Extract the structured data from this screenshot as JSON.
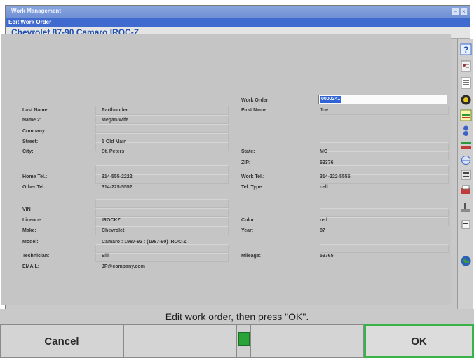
{
  "window": {
    "title": "Work Management",
    "subtitle": "Edit Work Order",
    "vehicle": "Chevrolet 87-90 Camaro IROC-Z"
  },
  "form": {
    "work_order": {
      "label": "Work Order:",
      "value": "0000241"
    },
    "last_name": {
      "label": "Last Name:",
      "value": "Parthunder"
    },
    "first_name": {
      "label": "First Name:",
      "value": "Joe"
    },
    "name2": {
      "label": "Name 2:",
      "value": "Megan-wife"
    },
    "company": {
      "label": "Company:",
      "value": ""
    },
    "street": {
      "label": "Street:",
      "value": "1 Old Main"
    },
    "city": {
      "label": "City:",
      "value": "St. Peters"
    },
    "state": {
      "label": "State:",
      "value": "MO"
    },
    "zip": {
      "label": "ZIP:",
      "value": "63376"
    },
    "home_tel": {
      "label": "Home Tel.:",
      "value": "314-555-2222"
    },
    "work_tel": {
      "label": "Work Tel.:",
      "value": "314-222-5555"
    },
    "other_tel": {
      "label": "Other Tel.:",
      "value": "314-225-5552"
    },
    "tel_type": {
      "label": "Tel. Type:",
      "value": "cell"
    },
    "vin": {
      "label": "VIN",
      "value": ""
    },
    "licence": {
      "label": "Licence:",
      "value": "IROCKZ"
    },
    "color": {
      "label": "Color:",
      "value": "red"
    },
    "make": {
      "label": "Make:",
      "value": "Chevrolet"
    },
    "year": {
      "label": "Year:",
      "value": "87"
    },
    "model": {
      "label": "Model:",
      "value": "Camaro : 1987-92 : (1987-90) IROC-Z"
    },
    "technician": {
      "label": "Technician:",
      "value": "Bill"
    },
    "mileage": {
      "label": "Mileage:",
      "value": "53765"
    },
    "email": {
      "label": "EMAIL:",
      "value": "JP@company.com"
    }
  },
  "status_message": "Edit work order, then press \"OK\".",
  "buttons": {
    "cancel": "Cancel",
    "ok": "OK"
  },
  "sidebar_icons": [
    "help-icon",
    "vehicle-specs-icon",
    "report-icon",
    "wheel-icon",
    "alignment-icon",
    "sensor-icon",
    "camber-icon",
    "caster-icon",
    "toe-icon",
    "print-icon",
    "tools-icon",
    "globe-icon"
  ],
  "colors": {
    "accent": "#3f6ad0",
    "ok_border": "#39b24a",
    "selection": "#2f63d6"
  }
}
